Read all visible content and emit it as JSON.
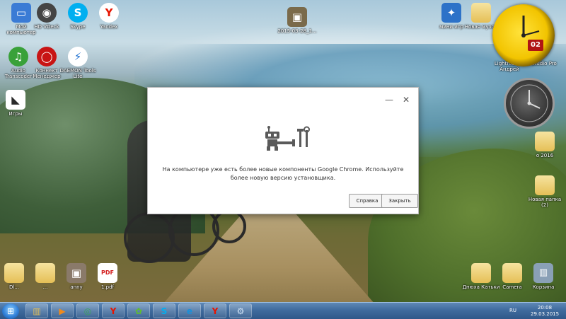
{
  "desktop": {
    "icons": [
      {
        "label": "Мой компьютер",
        "icon": "computer-icon",
        "color": "#3a7bd5",
        "glyph": "▭"
      },
      {
        "label": "HD VDeck",
        "icon": "speaker-icon",
        "color": "#444444",
        "glyph": "◉"
      },
      {
        "label": "Skype",
        "icon": "skype-icon",
        "color": "#00aff0",
        "glyph": "S"
      },
      {
        "label": "Yandex",
        "icon": "yandex-icon",
        "color": "#e61400",
        "glyph": "Y"
      },
      {
        "label": "Audio Transcoder",
        "icon": "transcoder-icon",
        "color": "#39a13a",
        "glyph": "♫"
      },
      {
        "label": "Коннект Менеджер",
        "icon": "connect-manager-icon",
        "color": "#c81414",
        "glyph": "◯"
      },
      {
        "label": "DAEMON Tools Lite",
        "icon": "daemon-tools-icon",
        "color": "#1c6fd1",
        "glyph": "⚡"
      },
      {
        "label": "Игры",
        "icon": "games-icon",
        "color": "#2a2a2a",
        "glyph": "◣"
      },
      {
        "label": "2015-03-28_1...",
        "icon": "image-file-icon",
        "color": "#7a6a4a",
        "glyph": "▣"
      },
      {
        "label": "мини игр",
        "icon": "games-shortcut-icon",
        "color": "#2d72c8",
        "glyph": "✦"
      },
      {
        "label": "Новая музон",
        "icon": "folder-icon",
        "color": "#e5bf56",
        "glyph": ""
      },
      {
        "label": "Lightroom 5 Андрей",
        "icon": "lightroom-icon",
        "color": "#2b2b2b",
        "glyph": "Lr"
      },
      {
        "label": "Studio Pro",
        "icon": "studio-icon",
        "color": "#2b2b2b",
        "glyph": "▤"
      },
      {
        "label": "о 2016",
        "icon": "folder-icon",
        "color": "#e5bf56",
        "glyph": ""
      },
      {
        "label": "Новая папка (2)",
        "icon": "folder-icon",
        "color": "#e5bf56",
        "glyph": ""
      },
      {
        "label": "Dl...",
        "icon": "folder-icon",
        "color": "#e5bf56",
        "glyph": ""
      },
      {
        "label": "...",
        "icon": "folder-icon",
        "color": "#e5bf56",
        "glyph": ""
      },
      {
        "label": "anny",
        "icon": "image-file-icon",
        "color": "#8a7a6a",
        "glyph": "▣"
      },
      {
        "label": "1.pdf",
        "icon": "pdf-icon",
        "color": "#d42020",
        "glyph": "PDF"
      },
      {
        "label": "Днюха Катьки",
        "icon": "folder-icon",
        "color": "#e5bf56",
        "glyph": ""
      },
      {
        "label": "Camera",
        "icon": "folder-icon",
        "color": "#e5bf56",
        "glyph": ""
      },
      {
        "label": "Корзина",
        "icon": "recycle-bin-icon",
        "color": "#8aa0b6",
        "glyph": "🗑"
      }
    ],
    "gadget_clock_day": "02"
  },
  "dialog": {
    "message": "На компьютере уже есть более новые компоненты Google Chrome. Используйте более новую версию установщика.",
    "help_label": "Справка",
    "close_label": "Закрыть",
    "minimize_glyph": "—",
    "close_glyph": "✕"
  },
  "taskbar": {
    "start_glyph": "⊞",
    "items": [
      {
        "icon": "explorer-icon",
        "glyph": "▥",
        "color": "#e5bf56"
      },
      {
        "icon": "media-player-icon",
        "glyph": "▶",
        "color": "#f08a1c"
      },
      {
        "icon": "chrome-icon",
        "glyph": "◎",
        "color": "#3aa757"
      },
      {
        "icon": "yandex-browser-icon",
        "glyph": "Y",
        "color": "#e61400"
      },
      {
        "icon": "icq-icon",
        "glyph": "✿",
        "color": "#5fbf2b"
      },
      {
        "icon": "skype-icon",
        "glyph": "S",
        "color": "#00aff0"
      },
      {
        "icon": "ie-icon",
        "glyph": "e",
        "color": "#1b8fd8"
      },
      {
        "icon": "yandex-icon",
        "glyph": "Y",
        "color": "#e61400"
      },
      {
        "icon": "setup-icon",
        "glyph": "⚙",
        "color": "#6a9ad0"
      }
    ],
    "language": "RU",
    "time": "20:08",
    "date": "29.03.2015"
  }
}
